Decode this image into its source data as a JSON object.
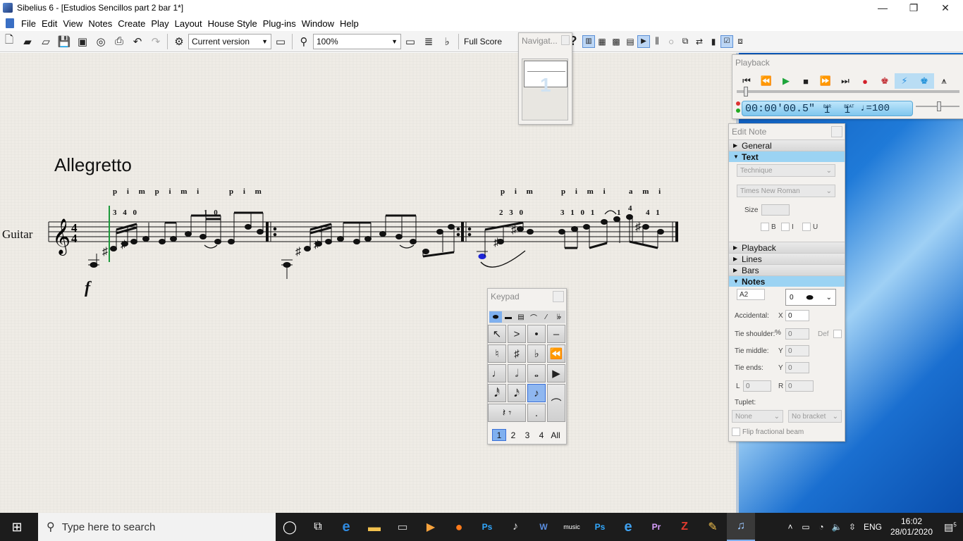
{
  "window": {
    "title": "Sibelius 6 - [Estudios Sencillos part 2 bar 1*]",
    "minimize": "—",
    "maximize": "❐",
    "close": "✕"
  },
  "menu": {
    "items": [
      "File",
      "Edit",
      "View",
      "Notes",
      "Create",
      "Play",
      "Layout",
      "House Style",
      "Plug-ins",
      "Window",
      "Help"
    ]
  },
  "toolbar": {
    "version_select": "Current version",
    "zoom": "100%",
    "view_button": "Full Score"
  },
  "navigator": {
    "title": "Navigat...",
    "page_number": "1"
  },
  "score": {
    "tempo_text": "Allegretto",
    "instrument": "Guitar",
    "dynamic": "f",
    "time_signature_top": "4",
    "time_signature_bottom": "4",
    "rh_fingering": [
      {
        "text": "p i m p i m i",
        "pos": "a"
      },
      {
        "text": "p i m",
        "pos": "b"
      },
      {
        "text": "p i m",
        "pos": "c"
      },
      {
        "text": "p i m i",
        "pos": "d"
      },
      {
        "text": "a m i",
        "pos": "e"
      }
    ],
    "lh_fingering": [
      {
        "text": "3 4 0",
        "pos": "a"
      },
      {
        "text": "1 0",
        "pos": "b"
      },
      {
        "text": "2 3 0",
        "pos": "c"
      },
      {
        "text": "3 1 0 1",
        "pos": "d"
      },
      {
        "text": "1",
        "pos": "e"
      },
      {
        "text": "4",
        "pos": "f"
      },
      {
        "text": "4 1",
        "pos": "g"
      }
    ]
  },
  "playback": {
    "title": "Playback",
    "time": "00:00'00.5\"",
    "bar_label": "BAR",
    "bar": "1",
    "beat_label": "BEAT",
    "beat": "1",
    "tempo": "♩=100"
  },
  "edit_note": {
    "title": "Edit Note",
    "sections": {
      "general": "General",
      "text": "Text",
      "playback": "Playback",
      "lines": "Lines",
      "bars": "Bars",
      "notes": "Notes"
    },
    "text_style": "Technique",
    "font": "Times New Roman",
    "size_label": "Size",
    "bold": "B",
    "italic": "I",
    "underline": "U",
    "pitch": "A2",
    "notehead": "0",
    "accidental_label": "Accidental:",
    "x_label": "X",
    "accidental_x": "0",
    "tie_shoulder_label": "Tie shoulder:",
    "percent": "%",
    "tie_shoulder": "0",
    "def_label": "Def",
    "tie_middle_label": "Tie middle:",
    "y_label": "Y",
    "tie_middle": "0",
    "tie_ends_label": "Tie ends:",
    "tie_ends": "0",
    "l_label": "L",
    "l_value": "0",
    "r_label": "R",
    "r_value": "0",
    "tuplet_label": "Tuplet:",
    "tuplet": "None",
    "bracket": "No bracket",
    "flip_beam": "Flip fractional beam"
  },
  "keypad": {
    "title": "Keypad",
    "voices": [
      "1",
      "2",
      "3",
      "4",
      "All"
    ]
  },
  "taskbar": {
    "search_placeholder": "Type here to search",
    "language": "ENG",
    "time": "16:02",
    "date": "28/01/2020",
    "notifications": "5"
  }
}
